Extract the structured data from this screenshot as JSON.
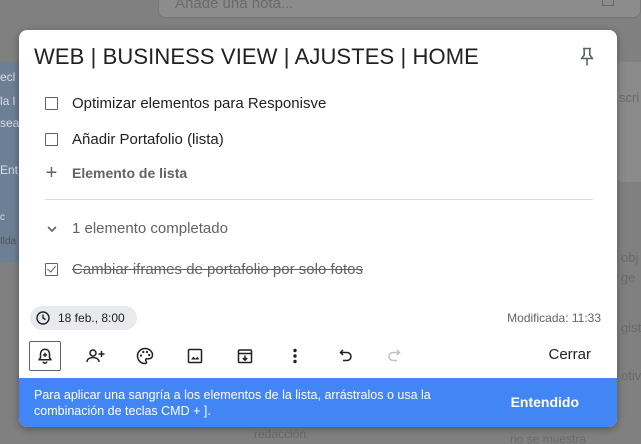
{
  "background": {
    "top_input_text": "Añade una nota...",
    "left_fragments": [
      "ecl",
      "la l",
      "sea",
      "Ent",
      "c",
      "Ilda"
    ],
    "right_fragments": [
      "scri",
      "obj",
      "ge",
      "gist",
      "otiv"
    ],
    "bottom_fragments": [
      "redacción",
      "no se muestra"
    ]
  },
  "note": {
    "title": "WEB | BUSINESS VIEW | AJUSTES | HOME",
    "items": [
      {
        "text": "Optimizar elementos para Responisve",
        "checked": false
      },
      {
        "text": "Añadir Portafolio (lista)",
        "checked": false
      }
    ],
    "add_item_label": "Elemento de lista",
    "completed_header": "1 elemento completado",
    "completed_items": [
      {
        "text": "Cambiar iframes de portafolio por solo fotos",
        "checked": true
      }
    ],
    "reminder": "18 feb., 8:00",
    "modified": "Modificada: 11:33",
    "close_label": "Cerrar"
  },
  "toolbar": {
    "icons": [
      "reminder-bell-icon",
      "collaborator-icon",
      "palette-icon",
      "image-icon",
      "archive-icon",
      "more-vert-icon",
      "undo-icon",
      "redo-icon"
    ]
  },
  "snackbar": {
    "message": "Para aplicar una sangría a los elementos de la lista, arrástralos o usa la combinación de teclas CMD + ].",
    "action": "Entendido"
  },
  "colors": {
    "snackbar": "#4285f4",
    "chip": "#e8eaed",
    "text_secondary": "#5f6368"
  }
}
